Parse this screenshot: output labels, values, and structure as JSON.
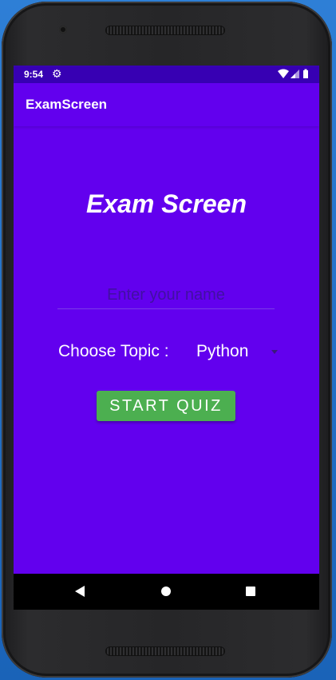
{
  "status_bar": {
    "time": "9:54",
    "settings_icon": "gear-icon",
    "wifi_icon": "wifi-icon",
    "signal_icon": "signal-icon",
    "battery_icon": "battery-icon"
  },
  "app_bar": {
    "title": "ExamScreen"
  },
  "main": {
    "heading": "Exam Screen",
    "name_input": {
      "value": "",
      "placeholder": "Enter your name"
    },
    "topic": {
      "label": "Choose Topic :",
      "selected": "Python",
      "dropdown_icon": "dropdown-arrow-icon"
    },
    "start_button_label": "START QUIZ"
  },
  "nav_bar": {
    "back_icon": "back-icon",
    "home_icon": "home-icon",
    "recents_icon": "recents-icon"
  },
  "colors": {
    "primary": "#6200ee",
    "primary_dark": "#3700b3",
    "button": "#4caf50"
  }
}
